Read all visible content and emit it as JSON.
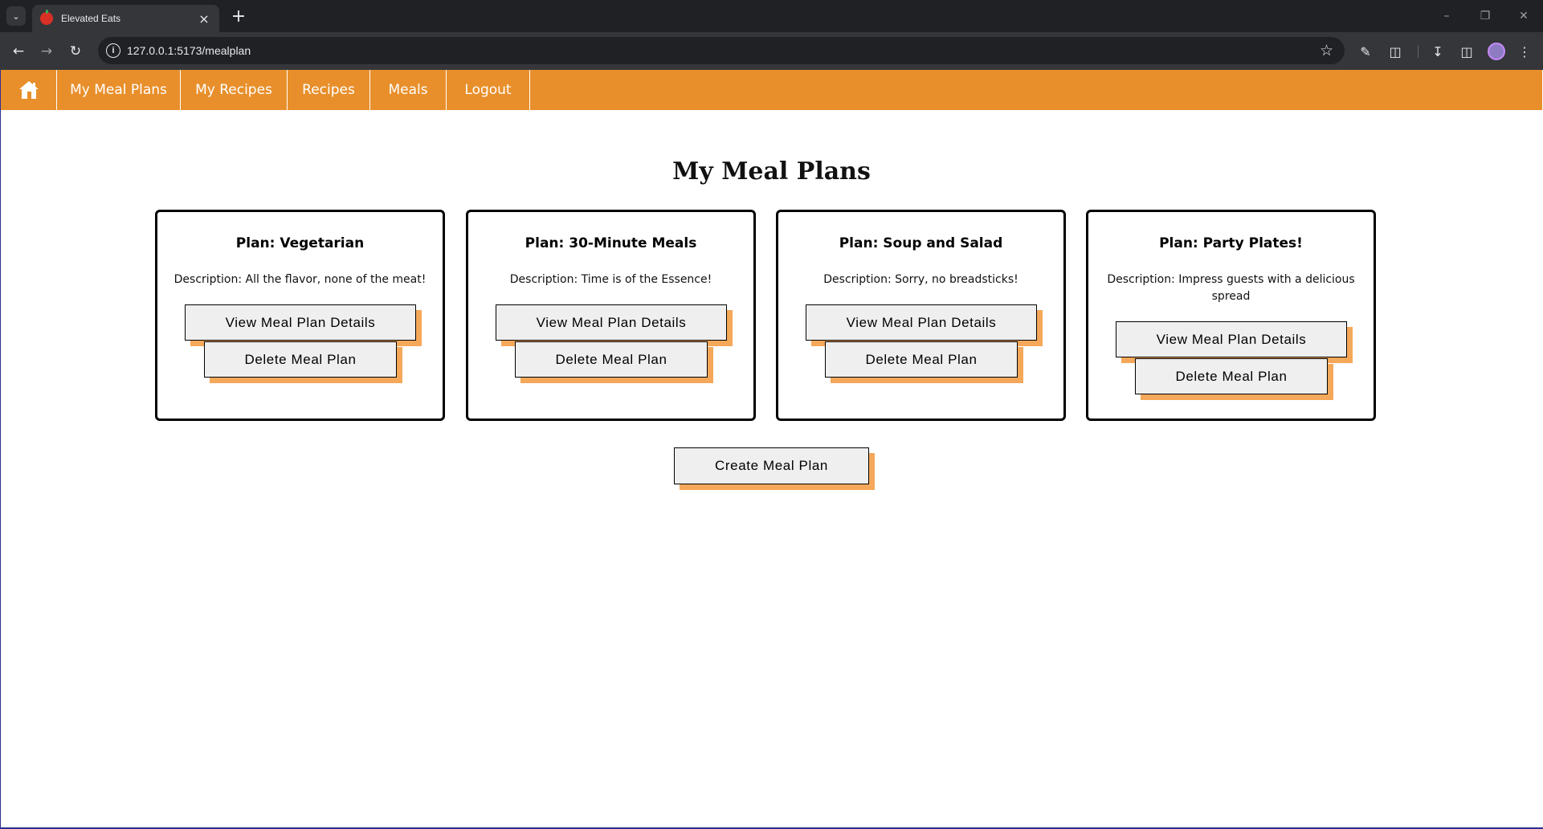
{
  "browser": {
    "tab_title": "Elevated Eats",
    "url": "127.0.0.1:5173/mealplan"
  },
  "nav": {
    "home_icon": "home-icon",
    "links": [
      "My Meal Plans",
      "My Recipes",
      "Recipes",
      "Meals",
      "Logout"
    ],
    "color": "#e88f2b"
  },
  "page": {
    "title": "My Meal Plans",
    "cards": [
      {
        "title": "Plan: Vegetarian",
        "description": "Description: All the flavor, none of the meat!",
        "view_label": "View Meal Plan Details",
        "delete_label": "Delete Meal Plan"
      },
      {
        "title": "Plan: 30-Minute Meals",
        "description": "Description: Time is of the Essence!",
        "view_label": "View Meal Plan Details",
        "delete_label": "Delete Meal Plan"
      },
      {
        "title": "Plan: Soup and Salad",
        "description": "Description: Sorry, no breadsticks!",
        "view_label": "View Meal Plan Details",
        "delete_label": "Delete Meal Plan"
      },
      {
        "title": "Plan: Party Plates!",
        "description": "Description: Impress guests with a delicious spread",
        "view_label": "View Meal Plan Details",
        "delete_label": "Delete Meal Plan"
      }
    ],
    "create_label": "Create Meal Plan",
    "button_shadow_color": "#f5a85a"
  }
}
